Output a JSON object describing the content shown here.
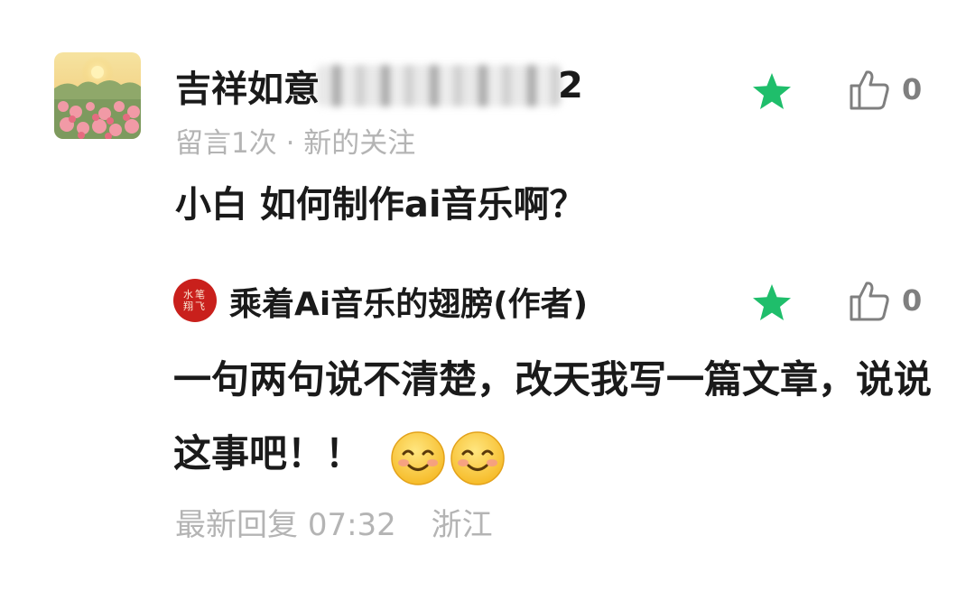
{
  "comment": {
    "user": {
      "name_prefix": "吉祥如意",
      "name_suffix": "2",
      "avatar": "sunset-flowers-avatar"
    },
    "meta": "留言1次 · 新的关注",
    "text": "小白 如何制作ai音乐啊？",
    "starred": true,
    "star_icon": "star-icon",
    "like_icon": "thumbs-up-icon",
    "like_count": "0",
    "colors": {
      "star": "#1fbe6b",
      "meta": "#b4b4b4",
      "text": "#1a1a1a"
    }
  },
  "reply": {
    "author": {
      "name": "乘着Ai音乐的翅膀(作者)",
      "avatar_text": [
        "水笔",
        "翔飞"
      ],
      "avatar_color": "#c9201c"
    },
    "text": "一句两句说不清楚，改天我写一篇文章，说说这事吧！！",
    "emojis": [
      "smiling-face-emoji",
      "smiling-face-emoji"
    ],
    "starred": true,
    "like_count": "0",
    "latest_reply_label": "最新回复",
    "time": "07:32",
    "location": "浙江"
  }
}
